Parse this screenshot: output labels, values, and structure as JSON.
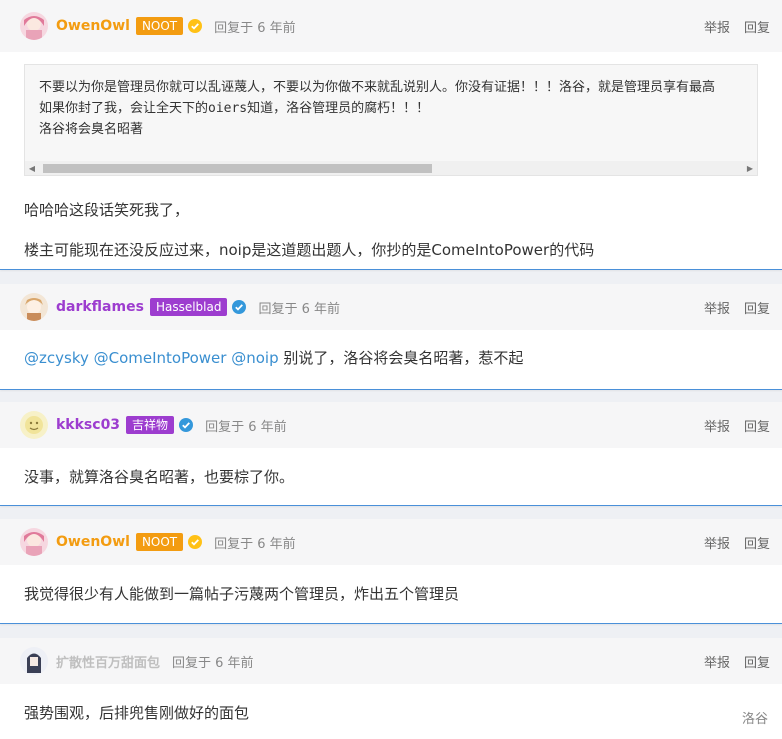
{
  "replies": [
    {
      "user": "OwenOwl",
      "user_color": "#f39c11",
      "badge": "NOOT",
      "badge_color": "#f39c11",
      "verified": true,
      "verify_color": "#ffc116",
      "time": "回复于 6 年前",
      "actions": {
        "report": "举报",
        "reply": "回复"
      },
      "code_lines": [
        "不要以为你是管理员你就可以乱诬蔑人，不要以为你做不来就乱说别人。你没有证据！！！洛谷，就是管理员享有最高",
        "如果你封了我，会让全天下的oiers知道，洛谷管理员的腐朽！！！",
        "洛谷将会臭名昭著"
      ],
      "paragraphs": [
        "哈哈哈这段话笑死我了，",
        "楼主可能现在还没反应过来，noip是这道题出题人，你抄的是ComeIntoPower的代码"
      ]
    },
    {
      "user": "darkflames",
      "user_color": "#9d3dcf",
      "badge": "Hasselblad",
      "badge_color": "#9d3dcf",
      "verified": true,
      "verify_color": "#3498db",
      "time": "回复于 6 年前",
      "actions": {
        "report": "举报",
        "reply": "回复"
      },
      "mentions": [
        "@zcysky",
        "@ComeIntoPower",
        "@noip"
      ],
      "text_after_mentions": "别说了，洛谷将会臭名昭著，惹不起"
    },
    {
      "user": "kkksc03",
      "user_color": "#9d3dcf",
      "badge": "吉祥物",
      "badge_color": "#9d3dcf",
      "verified": true,
      "verify_color": "#3498db",
      "time": "回复于 6 年前",
      "actions": {
        "report": "举报",
        "reply": "回复"
      },
      "text": "没事，就算洛谷臭名昭著，也要棕了你。"
    },
    {
      "user": "OwenOwl",
      "user_color": "#f39c11",
      "badge": "NOOT",
      "badge_color": "#f39c11",
      "verified": true,
      "verify_color": "#ffc116",
      "time": "回复于 6 年前",
      "actions": {
        "report": "举报",
        "reply": "回复"
      },
      "text": "我觉得很少有人能做到一篇帖子污蔑两个管理员，炸出五个管理员"
    },
    {
      "user": "扩散性百万甜面包",
      "user_color": "#bfbfbf",
      "time": "回复于 6 年前",
      "actions": {
        "report": "举报",
        "reply": "回复"
      },
      "text": "强势围观，后排兜售刚做好的面包"
    }
  ],
  "corner_author": "洛谷"
}
